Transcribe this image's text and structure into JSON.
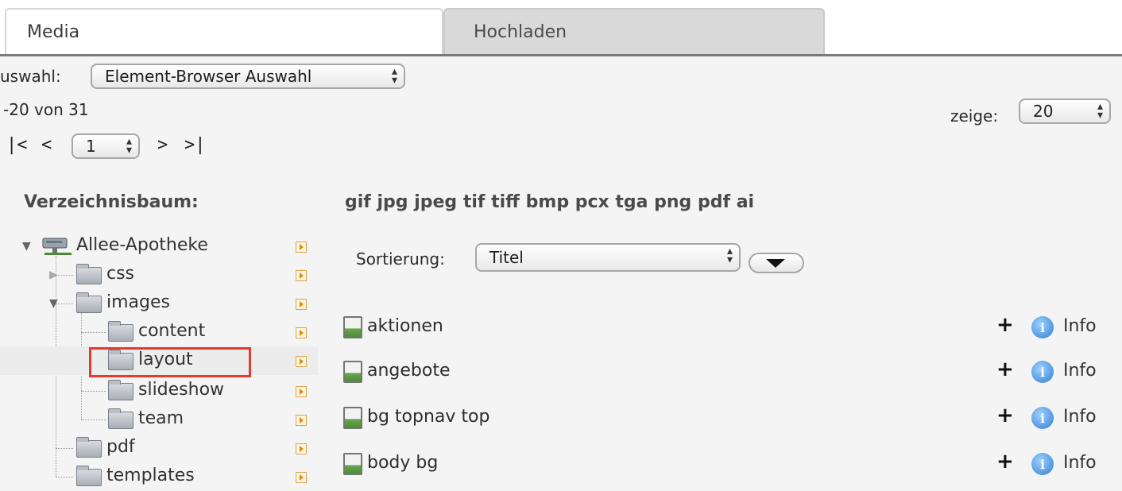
{
  "tabs": [
    {
      "label": "Media",
      "active": true
    },
    {
      "label": "Hochladen",
      "active": false
    }
  ],
  "selection": {
    "label": "uswahl:",
    "value": "Element-Browser Auswahl"
  },
  "range_text": "-20 von 31",
  "show": {
    "label": "zeige:",
    "value": "20"
  },
  "pager": {
    "first": "|<",
    "prev": "<",
    "page": "1",
    "next": ">",
    "last": ">|"
  },
  "tree": {
    "heading": "Verzeichnisbaum:",
    "items": [
      {
        "label": "Allee-Apotheke",
        "icon": "server-icon"
      },
      {
        "label": "css",
        "icon": "folder-icon"
      },
      {
        "label": "images",
        "icon": "folder-icon"
      },
      {
        "label": "content",
        "icon": "folder-icon"
      },
      {
        "label": "layout",
        "icon": "folder-icon",
        "selected": true
      },
      {
        "label": "slideshow",
        "icon": "folder-icon"
      },
      {
        "label": "team",
        "icon": "folder-icon"
      },
      {
        "label": "pdf",
        "icon": "folder-icon"
      },
      {
        "label": "templates",
        "icon": "folder-icon"
      }
    ]
  },
  "file_types": "gif jpg jpeg tif tiff bmp pcx tga png pdf ai",
  "sort": {
    "label": "Sortierung:",
    "value": "Titel"
  },
  "files": [
    {
      "name": "aktionen",
      "plus": "+",
      "info": "Info",
      "info_glyph": "i"
    },
    {
      "name": "angebote",
      "plus": "+",
      "info": "Info",
      "info_glyph": "i"
    },
    {
      "name": "bg topnav top",
      "plus": "+",
      "info": "Info",
      "info_glyph": "i"
    },
    {
      "name": "body bg",
      "plus": "+",
      "info": "Info",
      "info_glyph": "i"
    }
  ],
  "colors": {
    "highlight": "#e23b2e",
    "tab_inactive": "#d9d9d9"
  }
}
